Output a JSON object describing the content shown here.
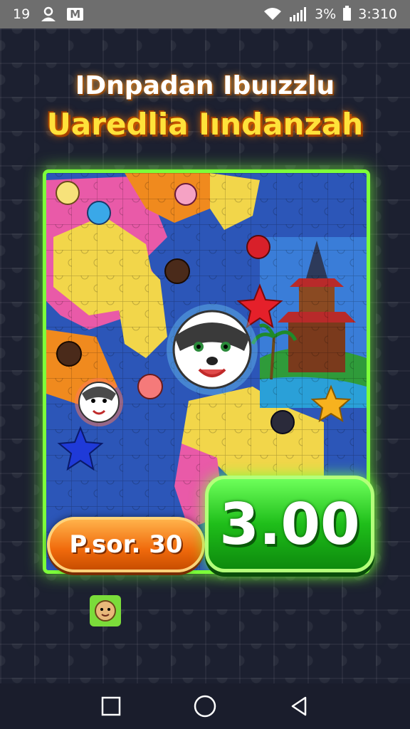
{
  "status_bar": {
    "time_left": "19",
    "notification_badge": "M",
    "battery_percent": "3%",
    "clock": "3:310",
    "icons": [
      "person-icon",
      "wifi-icon",
      "signal-icon",
      "battery-icon"
    ]
  },
  "header": {
    "title_line1": "IDnpadan Ibuızzlu",
    "title_line2": "Uaredlia Iındanzah"
  },
  "game": {
    "score_label": "P.sor. 30",
    "timer_value": "3.00",
    "colors": {
      "board_border": "#7dff3a",
      "score_pill": "#f06a0c",
      "timer_box": "#1fbe1a",
      "title_yellow": "#ffe23a"
    }
  },
  "nav_bar": {
    "icons": [
      "recents-square-icon",
      "home-circle-icon",
      "back-triangle-icon"
    ]
  }
}
